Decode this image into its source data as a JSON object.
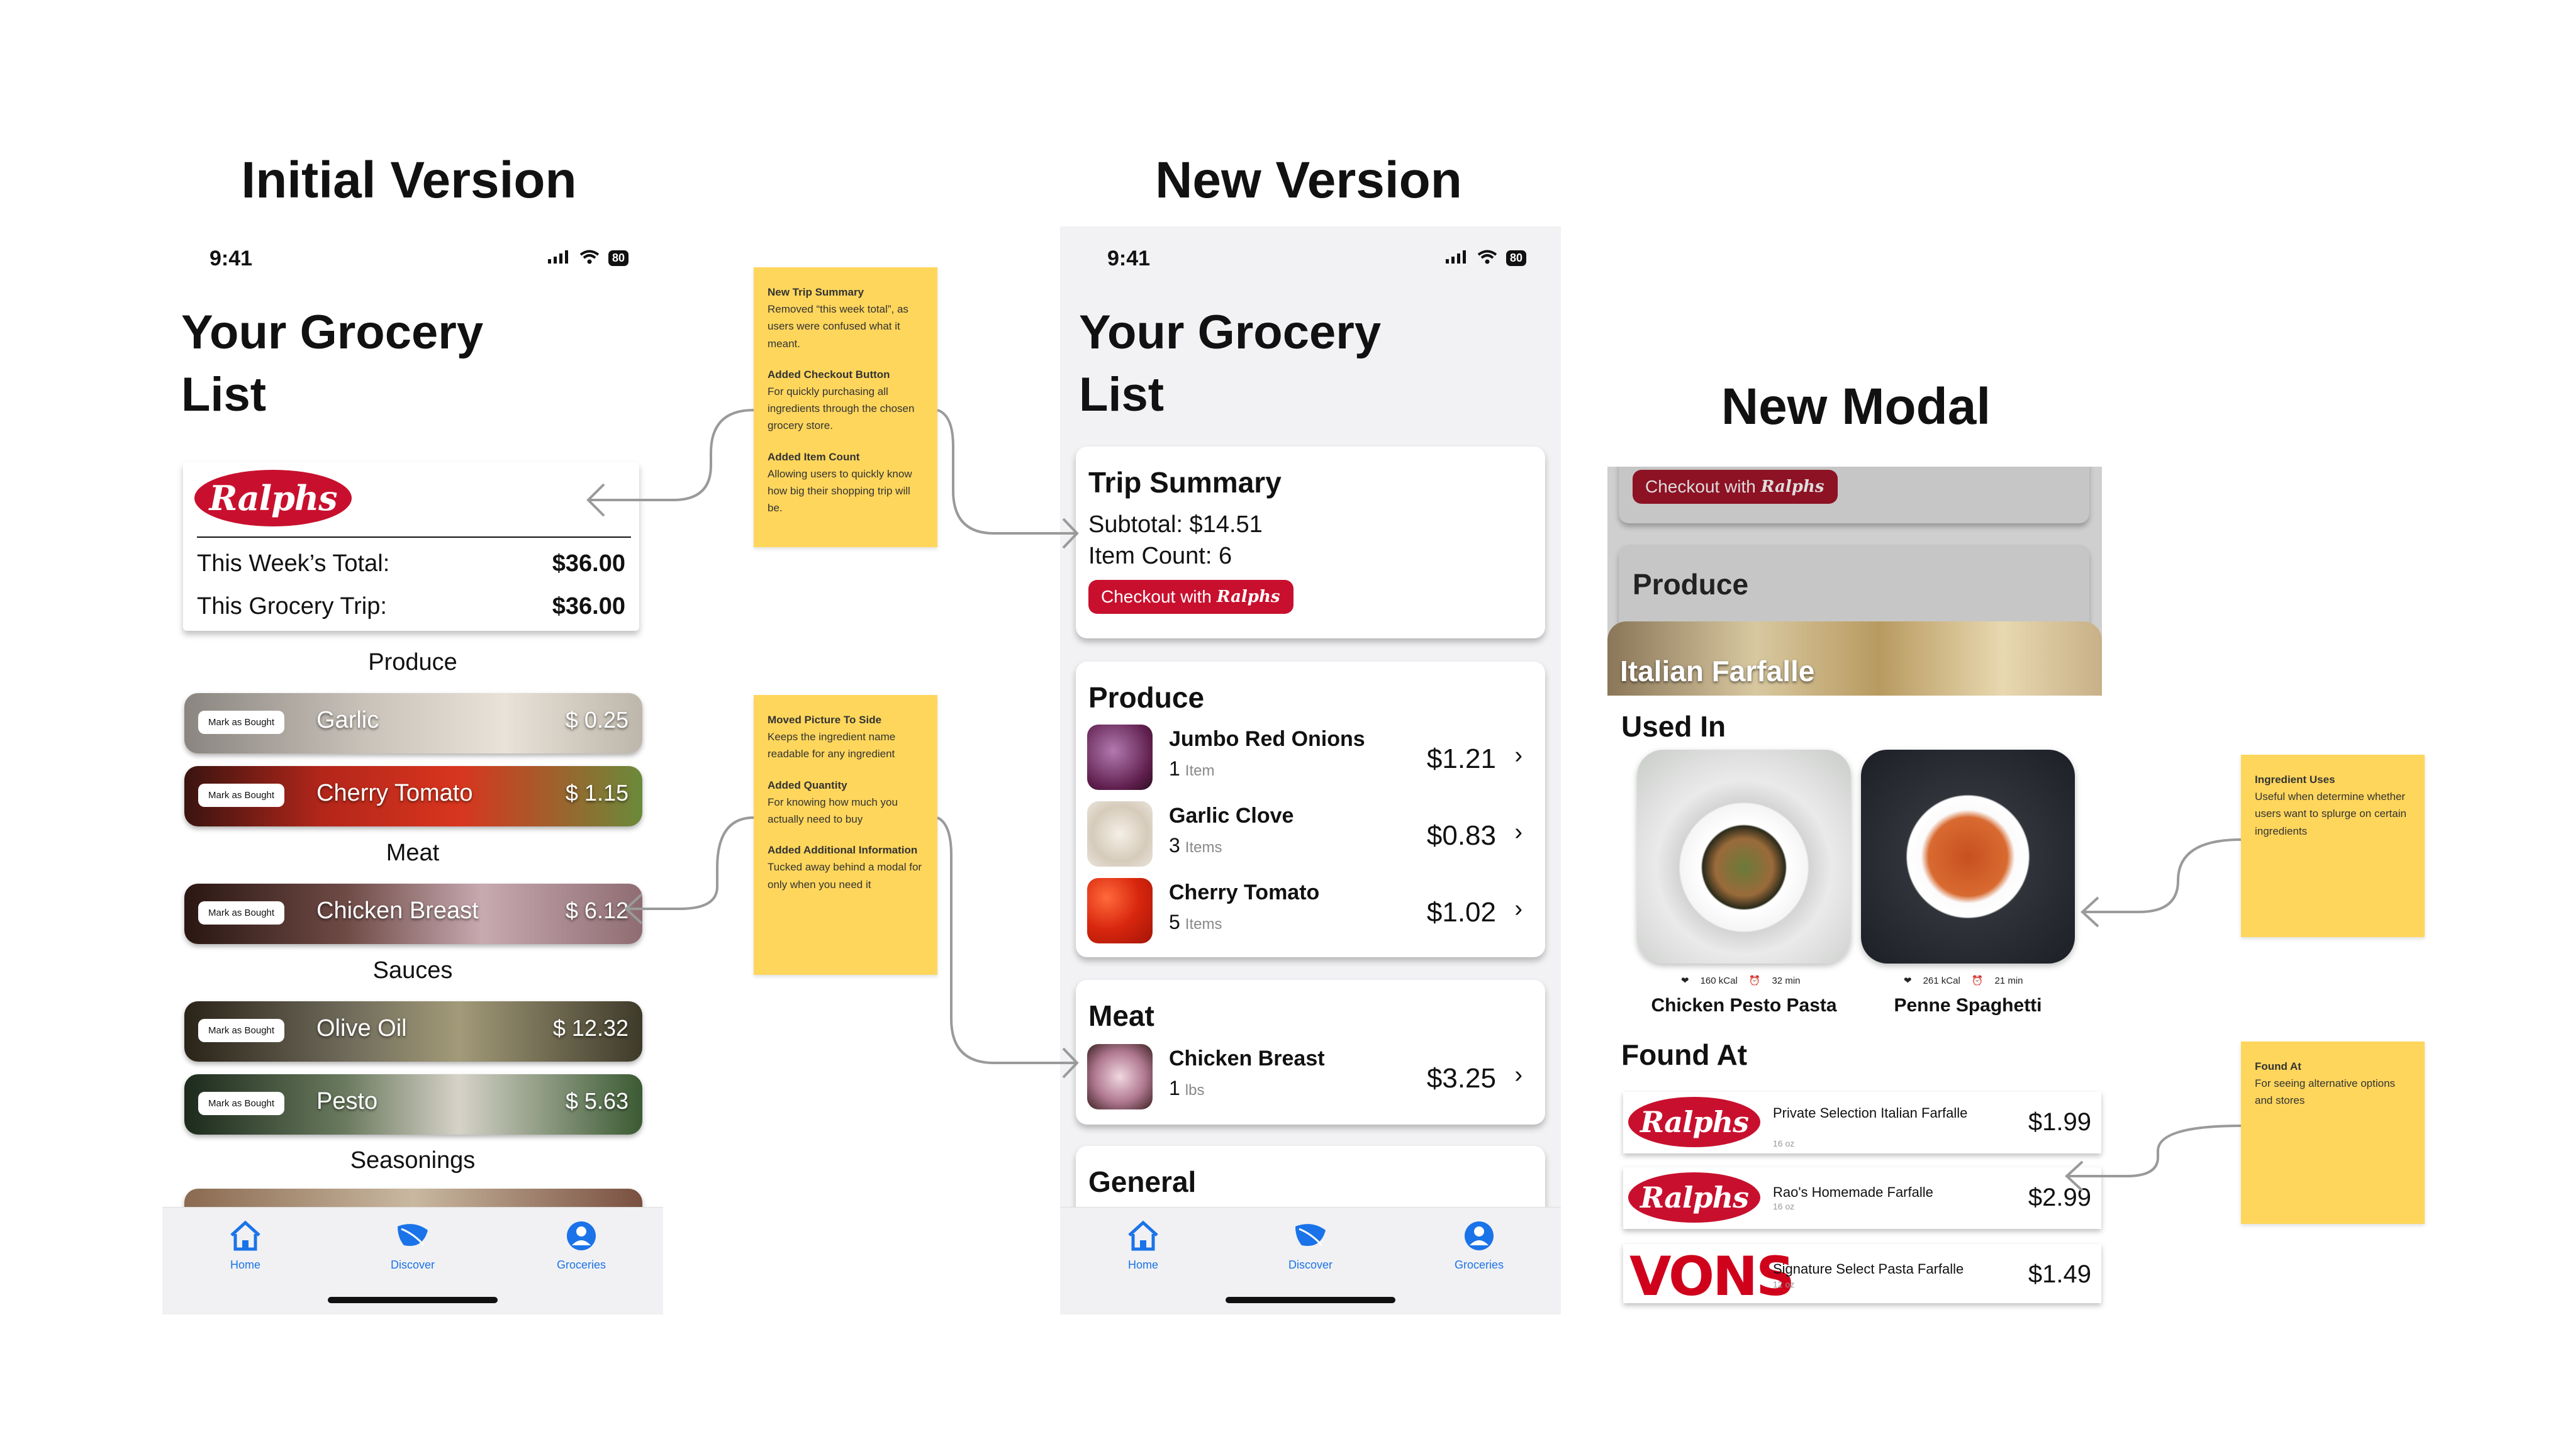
{
  "titles": {
    "initial": "Initial Version",
    "new": "New Version",
    "modal": "New Modal"
  },
  "status": {
    "time": "9:41",
    "battery": "80"
  },
  "list_title_line1": "Your Grocery",
  "list_title_line2": "List",
  "initial": {
    "store_logo": "Ralphs",
    "week_total_label": "This Week’s Total:",
    "week_total_value": "$36.00",
    "trip_label": "This Grocery Trip:",
    "trip_value": "$36.00",
    "mark_label": "Mark as Bought",
    "categories": [
      "Produce",
      "Meat",
      "Sauces",
      "Seasonings"
    ],
    "items": [
      {
        "name": "Garlic",
        "price": "$ 0.25"
      },
      {
        "name": "Cherry Tomato",
        "price": "$ 1.15"
      },
      {
        "name": "Chicken Breast",
        "price": "$ 6.12"
      },
      {
        "name": "Olive Oil",
        "price": "$ 12.32"
      },
      {
        "name": "Pesto",
        "price": "$ 5.63"
      }
    ]
  },
  "tabs": [
    "Home",
    "Discover",
    "Groceries"
  ],
  "new": {
    "trip_summary_title": "Trip Summary",
    "subtotal": "Subtotal: $14.51",
    "item_count": "Item Count: 6",
    "checkout_label": "Checkout with",
    "checkout_logo": "Ralphs",
    "produce_title": "Produce",
    "meat_title": "Meat",
    "general_title": "General",
    "produce_items": [
      {
        "name": "Jumbo Red Onions",
        "qty": "1",
        "unit": "Item",
        "price": "$1.21"
      },
      {
        "name": "Garlic Clove",
        "qty": "3",
        "unit": "Items",
        "price": "$0.83"
      },
      {
        "name": "Cherry Tomato",
        "qty": "5",
        "unit": "Items",
        "price": "$1.02"
      }
    ],
    "meat_items": [
      {
        "name": "Chicken Breast",
        "qty": "1",
        "unit": "lbs",
        "price": "$3.25"
      }
    ]
  },
  "modal": {
    "checkout_label": "Checkout with",
    "checkout_logo": "Ralphs",
    "produce_title": "Produce",
    "hero_title": "Italian Farfalle",
    "used_in_title": "Used In",
    "found_at_title": "Found At",
    "dishes": [
      {
        "name": "Chicken Pesto Pasta",
        "kcal": "160 kCal",
        "time": "32 min"
      },
      {
        "name": "Penne Spaghetti",
        "kcal": "261 kCal",
        "time": "21 min"
      }
    ],
    "stores": [
      {
        "logo": "Ralphs",
        "name": "Private Selection Italian Farfalle",
        "size": "16 oz",
        "price": "$1.99"
      },
      {
        "logo": "Ralphs",
        "name": "Rao's Homemade Farfalle",
        "size": "16 oz",
        "price": "$2.99"
      },
      {
        "logo": "VONS",
        "name": "Signature Select Pasta Farfalle",
        "size": "12 oz",
        "price": "$1.49"
      }
    ]
  },
  "notes": {
    "n1": [
      {
        "title": "New Trip Summary",
        "body": "Removed “this week total”, as users were confused what it meant."
      },
      {
        "title": "Added Checkout Button",
        "body": "For quickly purchasing all ingredients through the chosen grocery store."
      },
      {
        "title": "Added Item Count",
        "body": "Allowing users to quickly know how big their shopping trip will be."
      }
    ],
    "n2": [
      {
        "title": "Moved Picture To Side",
        "body": "Keeps the ingredient name readable for any ingredient"
      },
      {
        "title": "Added Quantity",
        "body": "For knowing how much you actually need to buy"
      },
      {
        "title": "Added Additional Information",
        "body": "Tucked away behind a modal for only when you need it"
      }
    ],
    "n3": [
      {
        "title": "Ingredient Uses",
        "body": "Useful when determine whether users want to splurge on certain ingredients"
      }
    ],
    "n4": [
      {
        "title": "Found At",
        "body": "For seeing alternative options and stores"
      }
    ]
  },
  "colors": {
    "brand_red": "#c8102e",
    "sticky": "#fed65c",
    "tab_blue": "#1a73e8"
  }
}
